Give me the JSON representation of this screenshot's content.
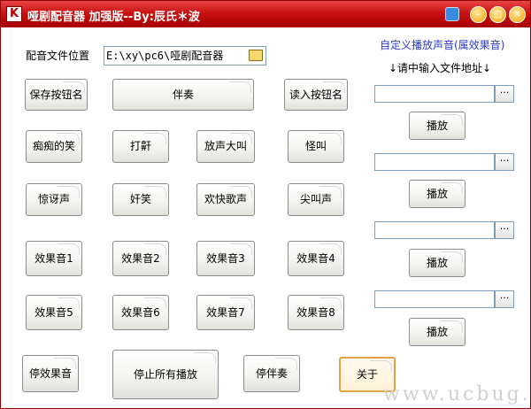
{
  "window": {
    "title": "哑剧配音器 加强版--By:辰氏＊波",
    "app_icon": "K"
  },
  "left": {
    "path_label": "配音文件位置",
    "path_value": "E:\\xy\\pc6\\哑剧配音器",
    "buttons": {
      "save": "保存按钮名",
      "accompany": "伴奏",
      "load": "读入按钮名",
      "r1": [
        "痴痴的笑",
        "打鼾",
        "放声大叫",
        "怪叫"
      ],
      "r2": [
        "惊讶声",
        "奸笑",
        "欢快歌声",
        "尖叫声"
      ],
      "r3": [
        "效果音1",
        "效果音2",
        "效果音3",
        "效果音4"
      ],
      "r4": [
        "效果音5",
        "效果音6",
        "效果音7",
        "效果音8"
      ],
      "stop_effect": "停效果音",
      "stop_all": "停止所有播放",
      "stop_accompany": "停伴奏",
      "about": "关于"
    }
  },
  "right": {
    "title": "自定义播放声音(属效果音)",
    "hint": "↓请中输入文件地址↓",
    "browse_label": "···",
    "play_label": "播放",
    "inputs": [
      "",
      "",
      "",
      ""
    ]
  },
  "watermark": "www.ucbug.cc"
}
